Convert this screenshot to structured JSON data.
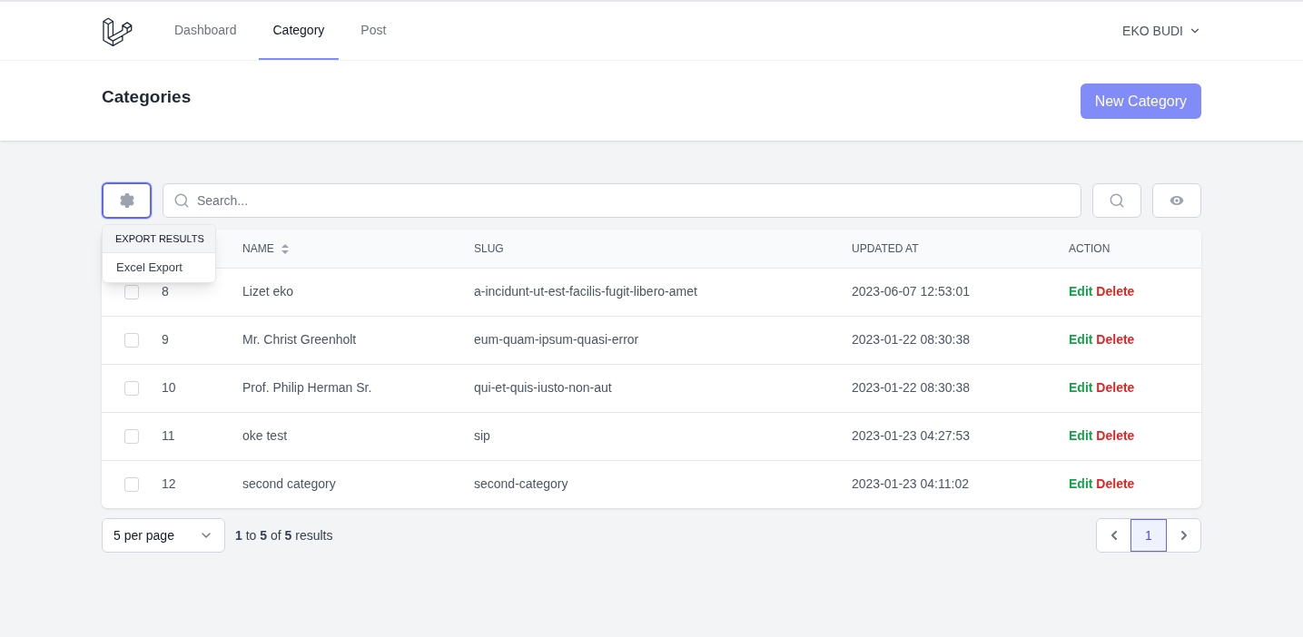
{
  "nav": {
    "items": [
      {
        "label": "Dashboard",
        "selected": false
      },
      {
        "label": "Category",
        "selected": true
      },
      {
        "label": "Post",
        "selected": false
      }
    ],
    "user": "EKO BUDI"
  },
  "page": {
    "title": "Categories",
    "new_button": "New Category"
  },
  "toolbar": {
    "search": {
      "placeholder": "Search..."
    },
    "menu": {
      "expanded": true,
      "header": "EXPORT RESULTS",
      "items": [
        "Excel Export"
      ]
    }
  },
  "table": {
    "columns": [
      {
        "label": "NAME",
        "sortable": true
      },
      {
        "label": "SLUG",
        "sortable": false
      },
      {
        "label": "UPDATED AT",
        "sortable": false
      },
      {
        "label": "ACTION",
        "sortable": false
      }
    ],
    "rows": [
      {
        "checked": false,
        "id": "8",
        "name": "Lizet eko",
        "slug": "a-incidunt-ut-est-facilis-fugit-libero-amet",
        "updated_at": "2023-06-07 12:53:01",
        "actions": [
          "Edit",
          "Delete"
        ]
      },
      {
        "checked": false,
        "id": "9",
        "name": "Mr. Christ Greenholt",
        "slug": "eum-quam-ipsum-quasi-error",
        "updated_at": "2023-01-22 08:30:38",
        "actions": [
          "Edit",
          "Delete"
        ]
      },
      {
        "checked": false,
        "id": "10",
        "name": "Prof. Philip Herman Sr.",
        "slug": "qui-et-quis-iusto-non-aut",
        "updated_at": "2023-01-22 08:30:38",
        "actions": [
          "Edit",
          "Delete"
        ]
      },
      {
        "checked": false,
        "id": "11",
        "name": "oke test",
        "slug": "sip",
        "updated_at": "2023-01-23 04:27:53",
        "actions": [
          "Edit",
          "Delete"
        ]
      },
      {
        "checked": false,
        "id": "12",
        "name": "second category",
        "slug": "second-category",
        "updated_at": "2023-01-23 04:11:02",
        "actions": [
          "Edit",
          "Delete"
        ]
      }
    ]
  },
  "footer": {
    "per_page": "5 per page",
    "results": "**1** to **5** of **5** results",
    "pages": [
      {
        "label": "1",
        "selected": true
      }
    ]
  }
}
